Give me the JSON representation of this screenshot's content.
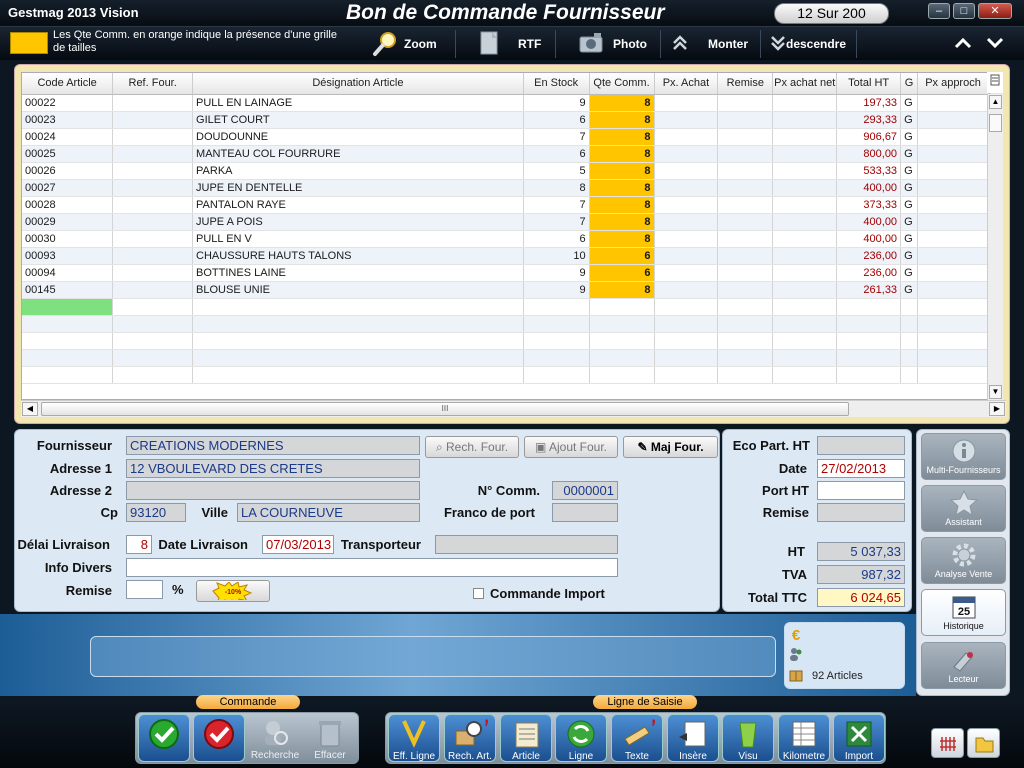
{
  "app_title": "Gestmag 2013 Vision",
  "window_title": "Bon de Commande Fournisseur",
  "record_counter": "12 Sur 200",
  "legend_text": "Les Qte Comm. en orange indique la présence d'une grille de tailles",
  "colors": {
    "accent_orange": "#ffc600",
    "total_red": "#a00000",
    "field_blue": "#1a3a8a",
    "selected_green": "#7ee07e"
  },
  "toolbar": {
    "zoom": "Zoom",
    "rtf": "RTF",
    "photo": "Photo",
    "monter": "Monter",
    "descendre": "descendre"
  },
  "grid": {
    "columns": [
      "Code Article",
      "Ref. Four.",
      "Désignation Article",
      "En Stock",
      "Qte Comm.",
      "Px. Achat",
      "Remise",
      "Px achat net",
      "Total HT",
      "G",
      "Px approch"
    ],
    "rows": [
      {
        "code": "00022",
        "ref": "",
        "designation": "PULL EN LAINAGE",
        "stock": "9",
        "qte": "8",
        "px_achat": "",
        "remise": "",
        "px_net": "",
        "total_ht": "197,33",
        "g": "G",
        "px_app": ""
      },
      {
        "code": "00023",
        "ref": "",
        "designation": "GILET COURT",
        "stock": "6",
        "qte": "8",
        "px_achat": "",
        "remise": "",
        "px_net": "",
        "total_ht": "293,33",
        "g": "G",
        "px_app": ""
      },
      {
        "code": "00024",
        "ref": "",
        "designation": "DOUDOUNNE",
        "stock": "7",
        "qte": "8",
        "px_achat": "",
        "remise": "",
        "px_net": "",
        "total_ht": "906,67",
        "g": "G",
        "px_app": ""
      },
      {
        "code": "00025",
        "ref": "",
        "designation": "MANTEAU COL FOURRURE",
        "stock": "6",
        "qte": "8",
        "px_achat": "",
        "remise": "",
        "px_net": "",
        "total_ht": "800,00",
        "g": "G",
        "px_app": ""
      },
      {
        "code": "00026",
        "ref": "",
        "designation": "PARKA",
        "stock": "5",
        "qte": "8",
        "px_achat": "",
        "remise": "",
        "px_net": "",
        "total_ht": "533,33",
        "g": "G",
        "px_app": ""
      },
      {
        "code": "00027",
        "ref": "",
        "designation": "JUPE EN DENTELLE",
        "stock": "8",
        "qte": "8",
        "px_achat": "",
        "remise": "",
        "px_net": "",
        "total_ht": "400,00",
        "g": "G",
        "px_app": ""
      },
      {
        "code": "00028",
        "ref": "",
        "designation": "PANTALON RAYE",
        "stock": "7",
        "qte": "8",
        "px_achat": "",
        "remise": "",
        "px_net": "",
        "total_ht": "373,33",
        "g": "G",
        "px_app": ""
      },
      {
        "code": "00029",
        "ref": "",
        "designation": "JUPE A POIS",
        "stock": "7",
        "qte": "8",
        "px_achat": "",
        "remise": "",
        "px_net": "",
        "total_ht": "400,00",
        "g": "G",
        "px_app": ""
      },
      {
        "code": "00030",
        "ref": "",
        "designation": "PULL EN V",
        "stock": "6",
        "qte": "8",
        "px_achat": "",
        "remise": "",
        "px_net": "",
        "total_ht": "400,00",
        "g": "G",
        "px_app": ""
      },
      {
        "code": "00093",
        "ref": "",
        "designation": "CHAUSSURE HAUTS TALONS",
        "stock": "10",
        "qte": "6",
        "px_achat": "",
        "remise": "",
        "px_net": "",
        "total_ht": "236,00",
        "g": "G",
        "px_app": ""
      },
      {
        "code": "00094",
        "ref": "",
        "designation": "BOTTINES LAINE",
        "stock": "9",
        "qte": "6",
        "px_achat": "",
        "remise": "",
        "px_net": "",
        "total_ht": "236,00",
        "g": "G",
        "px_app": ""
      },
      {
        "code": "00145",
        "ref": "",
        "designation": "BLOUSE UNIE",
        "stock": "9",
        "qte": "8",
        "px_achat": "",
        "remise": "",
        "px_net": "",
        "total_ht": "261,33",
        "g": "G",
        "px_app": ""
      }
    ],
    "scroll_grip": "III"
  },
  "form": {
    "fournisseur_label": "Fournisseur",
    "fournisseur": "CREATIONS MODERNES",
    "adresse1_label": "Adresse 1",
    "adresse1": "12 VBOULEVARD DES CRETES",
    "adresse2_label": "Adresse 2",
    "adresse2": "",
    "cp_label": "Cp",
    "cp": "93120",
    "ville_label": "Ville",
    "ville": "LA COURNEUVE",
    "ncomm_label": "N° Comm.",
    "ncomm": "0000001",
    "franco_label": "Franco de port",
    "franco": "",
    "delai_label": "Délai Livraison",
    "delai": "8",
    "date_livraison_label": "Date Livraison",
    "date_livraison": "07/03/2013",
    "transporteur_label": "Transporteur",
    "transporteur": "",
    "info_label": "Info Divers",
    "info": "",
    "remise_label": "Remise",
    "remise": "",
    "percent": "%",
    "discount_icon_text": "-10%",
    "commande_import_label": "Commande Import",
    "rech_four": "Rech. Four.",
    "ajout_four": "Ajout Four.",
    "maj_four": "Maj Four."
  },
  "totals": {
    "eco_label": "Eco Part. HT",
    "eco": "",
    "date_label": "Date",
    "date": "27/02/2013",
    "port_label": "Port HT",
    "port": "",
    "remise_label": "Remise",
    "remise": "",
    "ht_label": "HT",
    "ht": "5 037,33",
    "tva_label": "TVA",
    "tva": "987,32",
    "ttc_label": "Total TTC",
    "ttc": "6 024,65"
  },
  "side": {
    "multi": "Multi-Fournisseurs",
    "assistant": "Assistant",
    "analyse": "Analyse Vente",
    "historique": "Historique",
    "historique_day": "25",
    "lecteur": "Lecteur"
  },
  "articles_count": "92 Articles",
  "bottom": {
    "commande_label": "Commande",
    "ligne_label": "Ligne de Saisie",
    "recherche": "Recherche",
    "effacer": "Effacer",
    "eff_ligne": "Eff. Ligne",
    "rech_art": "Rech. Art.",
    "article": "Article",
    "ligne": "Ligne",
    "texte": "Texte",
    "insere": "Insère",
    "visu": "Visu",
    "kilometre": "Kilometre",
    "import": "Import"
  }
}
